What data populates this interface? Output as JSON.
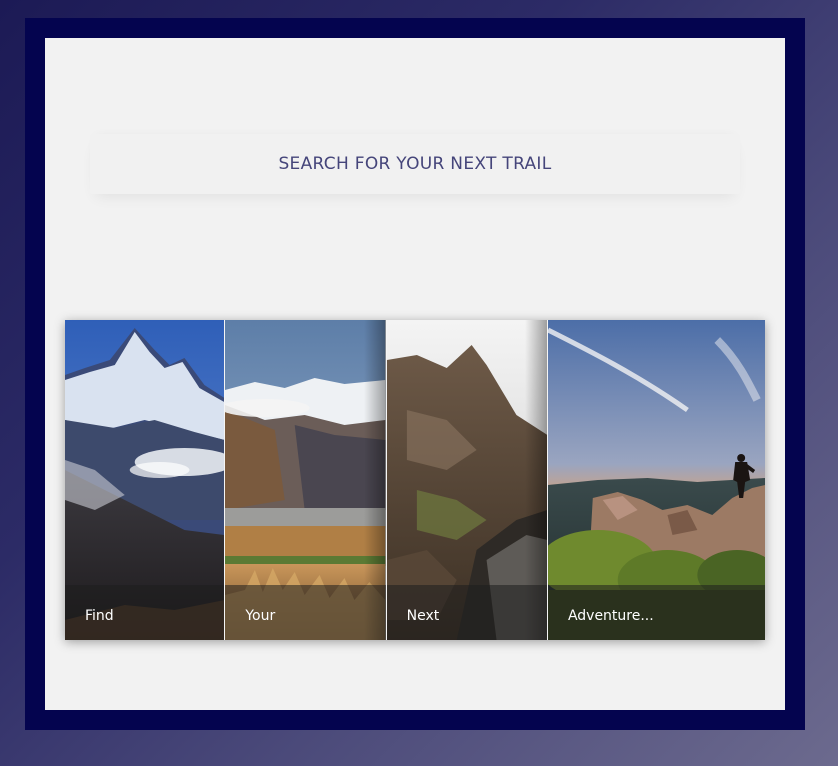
{
  "search": {
    "label": "SEARCH FOR YOUR NEXT TRAIL"
  },
  "gallery": {
    "cards": [
      {
        "caption": "Find"
      },
      {
        "caption": "Your"
      },
      {
        "caption": "Next"
      },
      {
        "caption": "Adventure..."
      }
    ]
  },
  "colors": {
    "frame": "#04044f",
    "panel": "#f2f2f2",
    "search_text": "#45457a"
  }
}
